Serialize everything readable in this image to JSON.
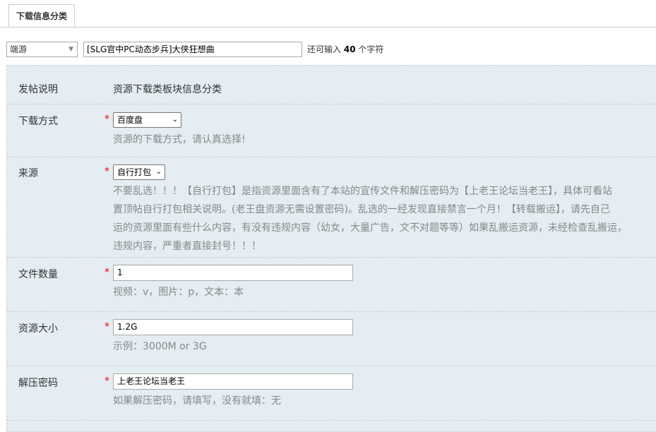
{
  "tabs": [
    {
      "label": "下载信息分类"
    }
  ],
  "top": {
    "category": "端游",
    "title_value": "[SLG官中PC动态步兵]大侠狂想曲",
    "counter_prefix": "还可输入",
    "counter_number": "40",
    "counter_suffix": "个字符"
  },
  "form": {
    "notice": {
      "label": "发帖说明",
      "value": "资源下载类板块信息分类"
    },
    "download_method": {
      "label": "下载方式",
      "required": "*",
      "selected": "百度盘",
      "hint": "资源的下载方式，请认真选择!"
    },
    "source": {
      "label": "来源",
      "required": "*",
      "selected": "自行打包",
      "hint_lines": [
        "不要乱选！！！【自行打包】是指资源里面含有了本站的宣传文件和解压密码为【上老王论坛当老王】，具体可看站",
        "置顶帖自行打包相关说明。(老王盘资源无需设置密码)。乱选的一经发现直接禁言一个月！【转载搬运】，请先自己",
        "运的资源里面有些什么内容，有没有违规内容（幼女，大量广告，文不对题等等）如果乱搬运资源，未经检查乱搬运，",
        "违规内容，严重者直接封号！！！"
      ]
    },
    "file_count": {
      "label": "文件数量",
      "required": "*",
      "value": "1",
      "hint": "视频：v，图片：p，文本：本"
    },
    "size": {
      "label": "资源大小",
      "required": "*",
      "value": "1.2G",
      "hint": "示例：3000M or 3G"
    },
    "password": {
      "label": "解压密码",
      "required": "*",
      "value": "上老王论坛当老王",
      "hint": "如果解压密码，请填写，没有就填：无"
    }
  },
  "icons": {
    "dropdown": "chevron-down-icon"
  }
}
